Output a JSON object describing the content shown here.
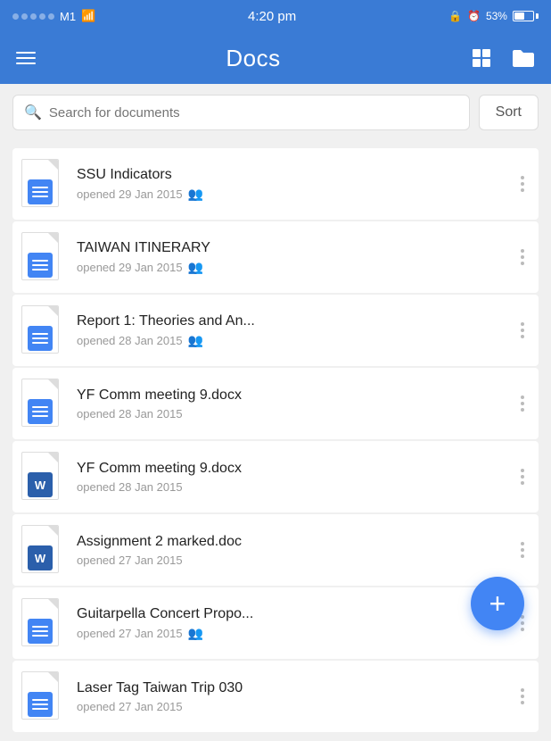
{
  "statusBar": {
    "carrier": "M1",
    "time": "4:20 pm",
    "lockIcon": "🔒",
    "alarmIcon": "⏰",
    "battery": "53%"
  },
  "header": {
    "title": "Docs"
  },
  "searchBar": {
    "placeholder": "Search for documents",
    "sortLabel": "Sort"
  },
  "documents": [
    {
      "id": 1,
      "name": "SSU Indicators",
      "meta": "opened 29 Jan 2015",
      "shared": true,
      "type": "docs"
    },
    {
      "id": 2,
      "name": "TAIWAN ITINERARY",
      "meta": "opened 29 Jan 2015",
      "shared": true,
      "type": "docs"
    },
    {
      "id": 3,
      "name": "Report 1: Theories and An...",
      "meta": "opened 28 Jan 2015",
      "shared": true,
      "type": "docs"
    },
    {
      "id": 4,
      "name": "YF Comm meeting 9.docx",
      "meta": "opened 28 Jan 2015",
      "shared": false,
      "type": "docs"
    },
    {
      "id": 5,
      "name": "YF Comm meeting 9.docx",
      "meta": "opened 28 Jan 2015",
      "shared": false,
      "type": "word"
    },
    {
      "id": 6,
      "name": "Assignment 2 marked.doc",
      "meta": "opened 27 Jan 2015",
      "shared": false,
      "type": "word"
    },
    {
      "id": 7,
      "name": "Guitarpella Concert Propo...",
      "meta": "opened 27 Jan 2015",
      "shared": true,
      "type": "docs"
    },
    {
      "id": 8,
      "name": "Laser Tag Taiwan Trip 030",
      "meta": "opened 27 Jan 2015",
      "shared": false,
      "type": "docs"
    }
  ],
  "fab": {
    "label": "+"
  }
}
